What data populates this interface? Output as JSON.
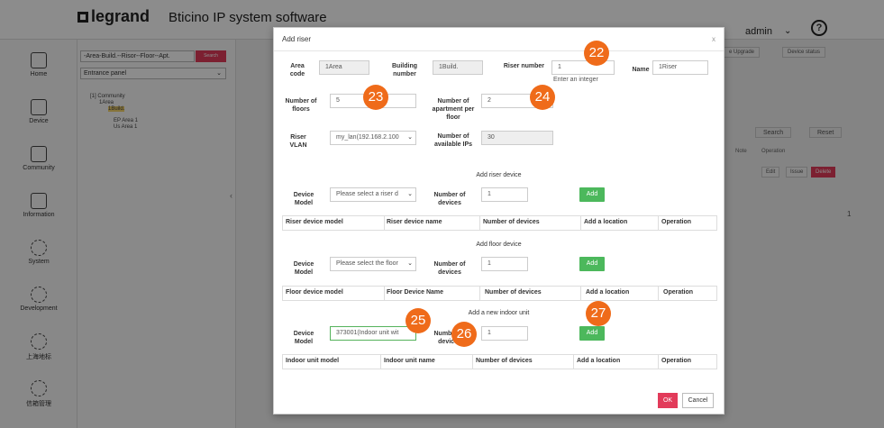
{
  "app": {
    "brand": "legrand",
    "brand_sub": "Bticino IP system software",
    "user": "admin",
    "help": "?"
  },
  "nav": [
    {
      "label": "Home",
      "icon": "home-icon"
    },
    {
      "label": "Device",
      "icon": "device-icon"
    },
    {
      "label": "Community",
      "icon": "community-icon"
    },
    {
      "label": "Information",
      "icon": "information-icon"
    },
    {
      "label": "System",
      "icon": "gear-icon"
    },
    {
      "label": "Development",
      "icon": "gear-icon"
    },
    {
      "label": "上海地标",
      "icon": "gear-icon"
    },
    {
      "label": "信箱管理",
      "icon": "gear-icon"
    }
  ],
  "tree_panel": {
    "path": "-Area-Build.--Risor--Floor--Apt.",
    "search": "Search",
    "panel_select": "Entrance panel",
    "tree": [
      "[1] Community",
      "1Area",
      "1Build.",
      "EP Area 1",
      "Us Area 1"
    ]
  },
  "background": {
    "top_buttons": [
      "e Upgrade",
      "Device status"
    ],
    "search": "Search",
    "reset": "Reset",
    "headers": [
      "Note",
      "Operation"
    ],
    "row_actions": [
      "Edit",
      "Issue",
      "Delete"
    ],
    "page": "1"
  },
  "modal": {
    "title": "Add riser",
    "close": "x",
    "area_code_label": "Area code",
    "area_code_value": "1Area",
    "building_number_label": "Building number",
    "building_number_value": "1Build.",
    "riser_number_label": "Riser number",
    "riser_number_value": "1",
    "riser_hint": "Enter an integer",
    "name_label": "Name",
    "name_value": "1Riser",
    "floors_label": "Number of floors",
    "floors_value": "5",
    "apartments_label": "Number of apartment per floor",
    "apartments_value": "2",
    "vlan_label": "Riser VLAN",
    "vlan_value": "my_lan(192.168.2.100",
    "available_ips_label": "Number of available IPs",
    "available_ips_value": "30",
    "riser_section": "Add riser device",
    "riser_model_label": "Device Model",
    "riser_model_placeholder": "Please select a riser d",
    "riser_devices_label": "Number of devices",
    "riser_devices_value": "1",
    "add": "Add",
    "riser_table": [
      "Riser device model",
      "Riser device name",
      "Number of devices",
      "Add a location",
      "Operation"
    ],
    "floor_section": "Add floor device",
    "floor_model_label": "Device Model",
    "floor_model_placeholder": "Please select the floor",
    "floor_devices_label": "Number of devices",
    "floor_devices_value": "1",
    "floor_table": [
      "Floor device model",
      "Floor Device Name",
      "Number of devices",
      "Add a location",
      "Operation"
    ],
    "indoor_section": "Add a new indoor unit",
    "indoor_model_label": "Device Model",
    "indoor_model_value": "373001(Indoor unit wit",
    "indoor_devices_label": "Number of devices",
    "indoor_devices_value": "1",
    "indoor_table": [
      "Indoor unit model",
      "Indoor unit name",
      "Number of devices",
      "Add a location",
      "Operation"
    ],
    "ok": "OK",
    "cancel": "Cancel"
  },
  "badges": [
    "22",
    "23",
    "24",
    "25",
    "26",
    "27"
  ],
  "colors": {
    "badge": "#ef6b1a",
    "add": "#4cb85c",
    "ok": "#e23b5a"
  }
}
